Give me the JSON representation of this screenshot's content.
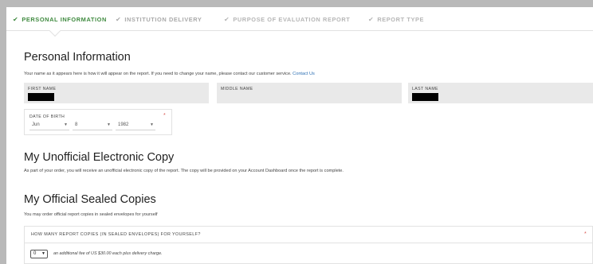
{
  "stepper": {
    "steps": [
      {
        "label": "PERSONAL INFORMATION",
        "check": "✔"
      },
      {
        "label": "INSTITUTION DELIVERY",
        "check": "✔"
      },
      {
        "label": "PURPOSE OF EVALUATION REPORT",
        "check": "✔"
      },
      {
        "label": "REPORT TYPE",
        "check": "✔"
      }
    ]
  },
  "personal": {
    "title": "Personal Information",
    "note": "Your name as it appears here is how it will appear on the report. If you need to change your name, please contact our customer service.",
    "contact_link": "Contact Us",
    "first_name_label": "FIRST NAME",
    "middle_name_label": "MIDDLE NAME",
    "last_name_label": "LAST NAME",
    "dob_label": "DATE OF BIRTH",
    "required_mark": "*",
    "dob_month": "Jun",
    "dob_day": "8",
    "dob_year": "1982"
  },
  "electronic": {
    "title": "My Unofficial Electronic Copy",
    "note": "As part of your order, you will receive an unofficial electronic copy of the report. The copy will be provided on your Account Dashboard once the report is complete."
  },
  "sealed": {
    "title": "My Official Sealed Copies",
    "note": "You may order official report copies in sealed envelopes for yourself",
    "question": "HOW MANY REPORT COPIES (IN SEALED ENVELOPES) FOR YOURSELF?",
    "required_mark": "*",
    "quantity": "0",
    "fee_note": "an additional fee of US $30.00 each plus delivery charge."
  },
  "icons": {
    "dropdown_arrow": "▼"
  },
  "colors": {
    "active_step": "#3f8a3f",
    "link": "#2c6fb3",
    "required": "#d9534f",
    "field_bg": "#e9e9e9"
  }
}
